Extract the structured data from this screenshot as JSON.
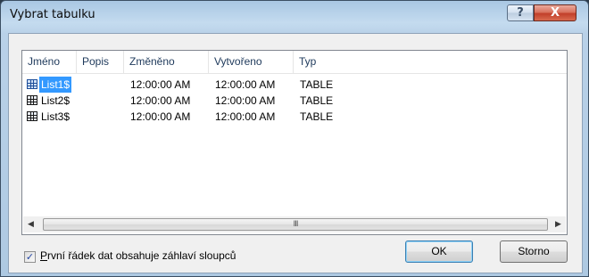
{
  "window": {
    "title": "Vybrat tabulku",
    "help_label": "?",
    "close_label": "X"
  },
  "list": {
    "columns": [
      "Jméno",
      "Popis",
      "Změněno",
      "Vytvořeno",
      "Typ"
    ],
    "rows": [
      {
        "name": "List1$",
        "description": "",
        "modified": "12:00:00 AM",
        "created": "12:00:00 AM",
        "type": "TABLE",
        "selected": true
      },
      {
        "name": "List2$",
        "description": "",
        "modified": "12:00:00 AM",
        "created": "12:00:00 AM",
        "type": "TABLE",
        "selected": false
      },
      {
        "name": "List3$",
        "description": "",
        "modified": "12:00:00 AM",
        "created": "12:00:00 AM",
        "type": "TABLE",
        "selected": false
      }
    ]
  },
  "scrollbar": {
    "left_arrow": "◀",
    "right_arrow": "▶",
    "grip": "III"
  },
  "options": {
    "header_row_checked": true,
    "header_row_first_letter": "P",
    "header_row_rest": "rvní řádek dat obsahuje záhlaví sloupců"
  },
  "buttons": {
    "ok_label": "OK",
    "cancel_label": "Storno"
  }
}
